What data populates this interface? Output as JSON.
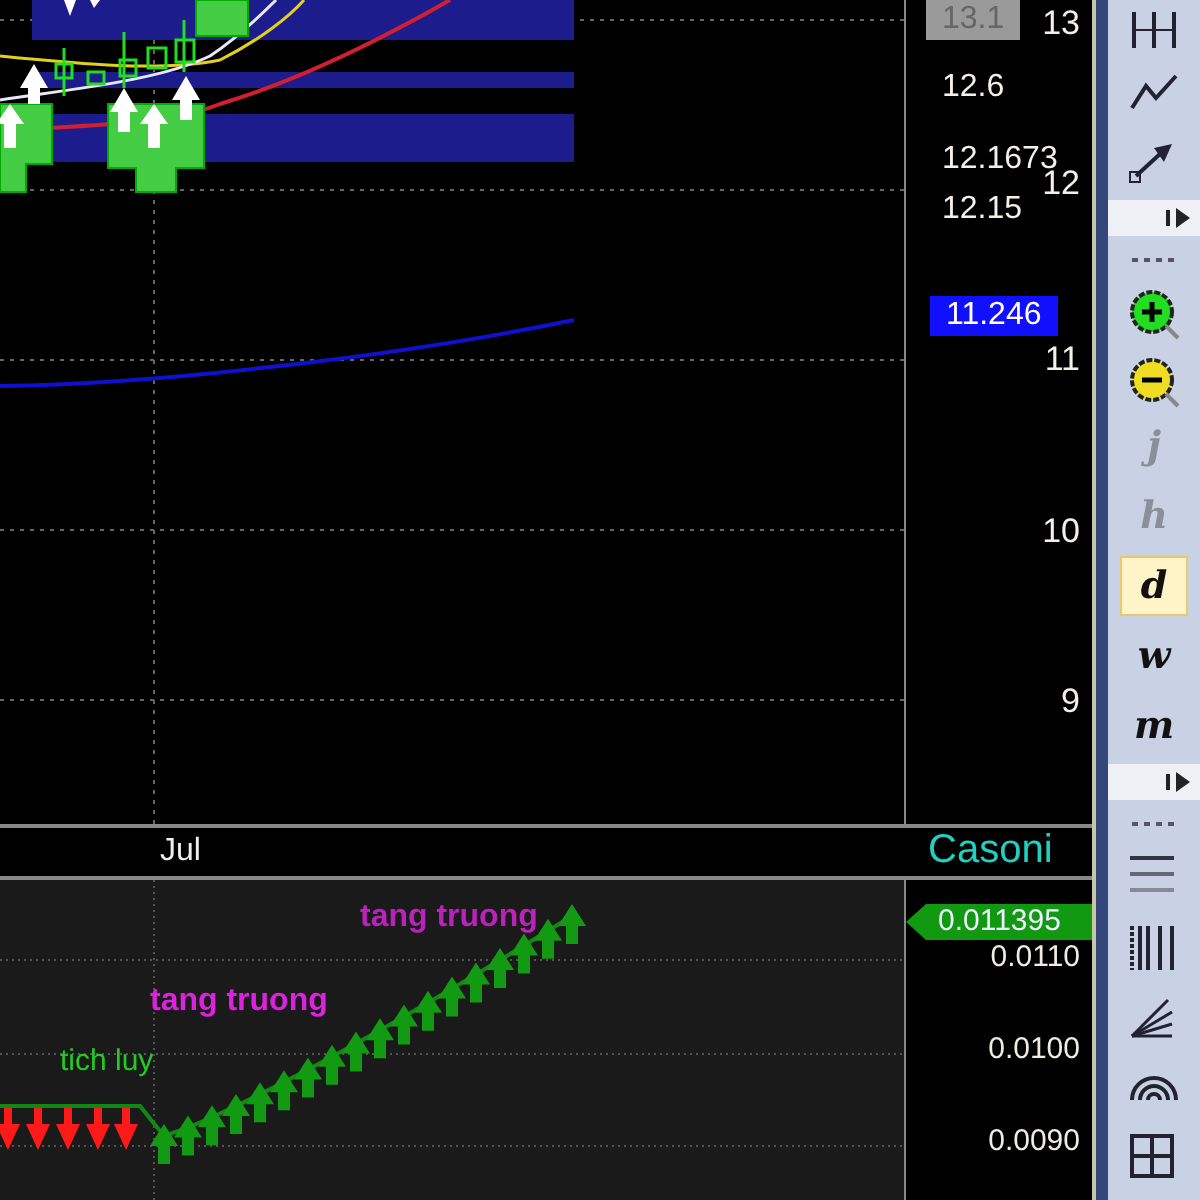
{
  "price_axis": {
    "labels": [
      {
        "text": "13.1",
        "kind": "marker"
      },
      {
        "text": "13",
        "kind": "tick"
      },
      {
        "text": "12.6",
        "kind": "level"
      },
      {
        "text": "12.1673",
        "kind": "level"
      },
      {
        "text": "12",
        "kind": "tick"
      },
      {
        "text": "12.15",
        "kind": "level"
      },
      {
        "text": "11.246",
        "kind": "last"
      },
      {
        "text": "11",
        "kind": "tick"
      },
      {
        "text": "10",
        "kind": "tick"
      },
      {
        "text": "9",
        "kind": "tick"
      }
    ]
  },
  "date_axis": {
    "label": "Jul"
  },
  "indicator": {
    "name": "Casoni",
    "annotations": [
      {
        "text": "tich luy",
        "color": "#22cc22"
      },
      {
        "text": "tang truong",
        "color": "#dd22dd"
      },
      {
        "text": "tang truong",
        "color": "#bb22bb"
      }
    ],
    "axis_labels": [
      {
        "text": "0.011395",
        "kind": "last"
      },
      {
        "text": "0.0110",
        "kind": "tick"
      },
      {
        "text": "0.0100",
        "kind": "tick"
      },
      {
        "text": "0.0090",
        "kind": "tick"
      }
    ]
  },
  "periods": [
    {
      "label": "j",
      "selected": false,
      "disabled": true
    },
    {
      "label": "h",
      "selected": false,
      "disabled": true
    },
    {
      "label": "d",
      "selected": true,
      "disabled": false
    },
    {
      "label": "w",
      "selected": false,
      "disabled": false
    },
    {
      "label": "m",
      "selected": false,
      "disabled": false
    }
  ]
}
